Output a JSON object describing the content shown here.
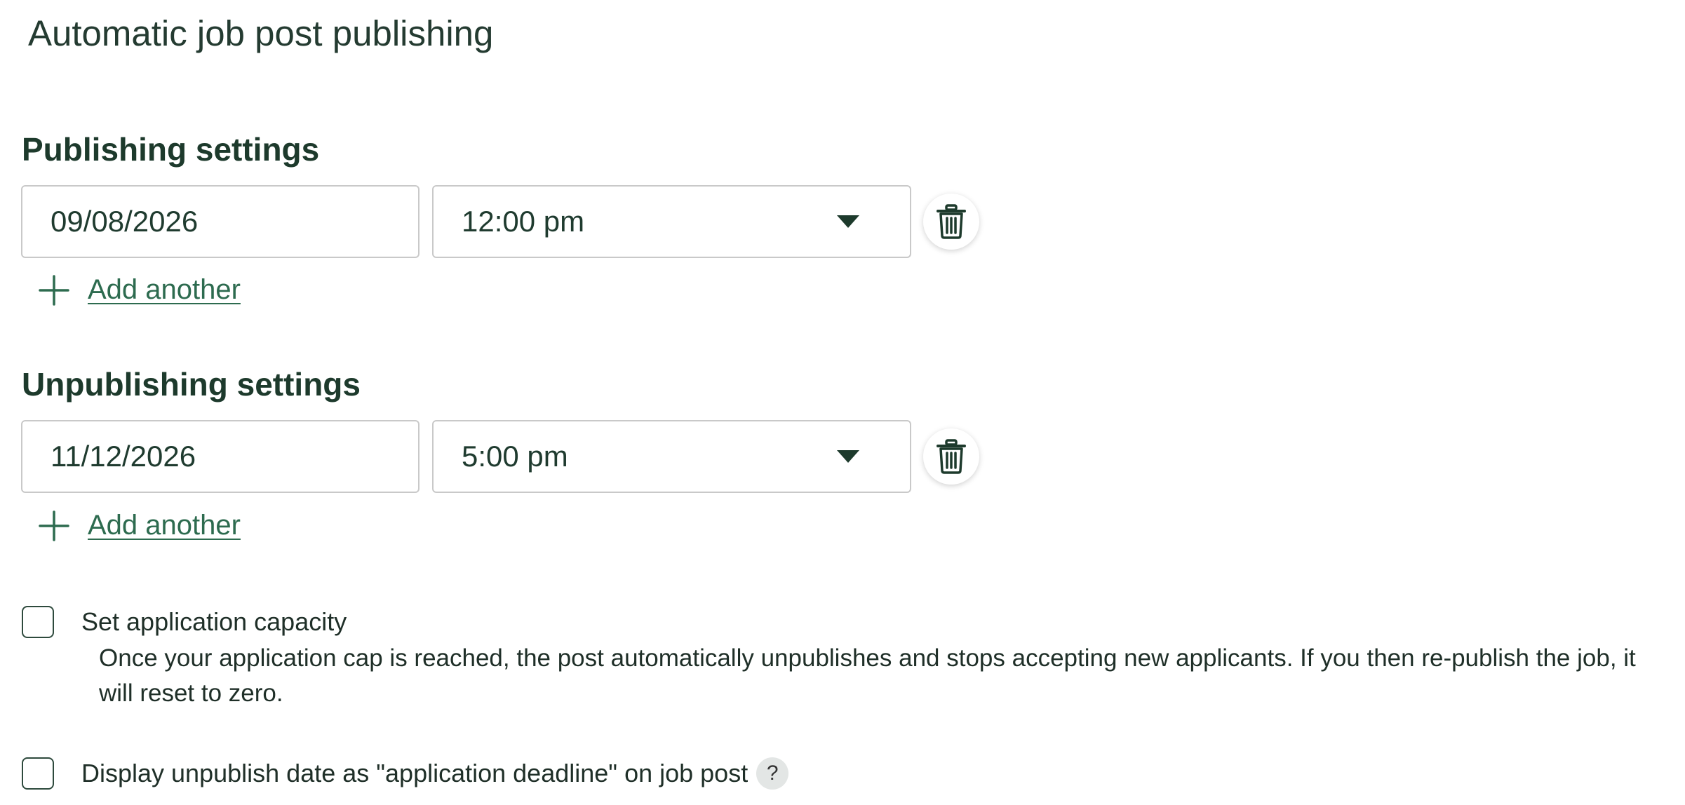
{
  "page": {
    "title": "Automatic job post publishing"
  },
  "publishing": {
    "heading": "Publishing settings",
    "date_value": "09/08/2026",
    "time_value": "12:00 pm",
    "add_label": "Add another"
  },
  "unpublishing": {
    "heading": "Unpublishing settings",
    "date_value": "11/12/2026",
    "time_value": "5:00 pm",
    "add_label": "Add another"
  },
  "capacity": {
    "label": "Set application capacity",
    "checked": false,
    "help": "Once your application cap is reached, the post automatically unpublishes and stops accepting new applicants. If you then re-publish the job, it will reset to zero."
  },
  "deadline": {
    "label": "Display unpublish date as \"application deadline\" on job post",
    "checked": false,
    "help_icon": "?"
  },
  "icons": {
    "delete": "trash-icon",
    "dropdown": "caret-down-icon",
    "add": "plus-icon",
    "help": "question-icon"
  },
  "colors": {
    "heading": "#1d3a2c",
    "link": "#2d6b4f",
    "border": "#c9c9c9"
  }
}
